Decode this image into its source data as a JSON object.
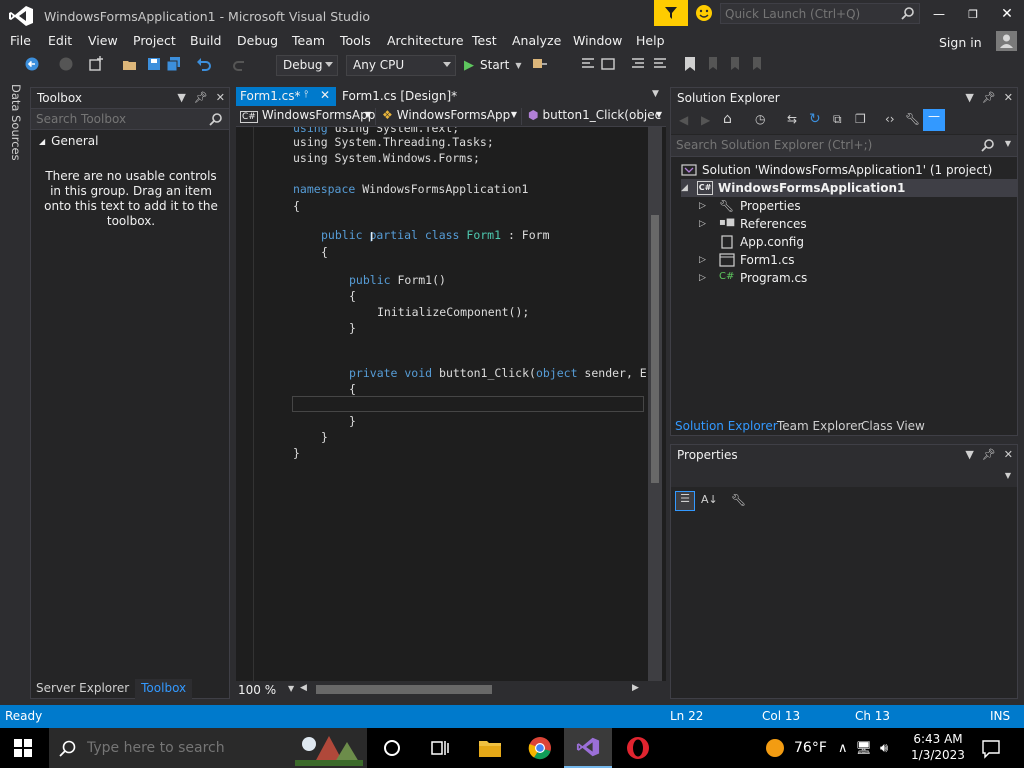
{
  "window": {
    "title": "WindowsFormsApplication1 - Microsoft Visual Studio",
    "quick_launch_placeholder": "Quick Launch (Ctrl+Q)"
  },
  "menu": [
    "File",
    "Edit",
    "View",
    "Project",
    "Build",
    "Debug",
    "Team",
    "Tools",
    "Architecture",
    "Test",
    "Analyze",
    "Window",
    "Help"
  ],
  "sign_in": "Sign in",
  "toolbar": {
    "config": "Debug",
    "platform": "Any CPU",
    "start": "Start"
  },
  "left_vertical_tab": "Data Sources",
  "toolbox": {
    "title": "Toolbox",
    "search_placeholder": "Search Toolbox",
    "group": "General",
    "empty_message": "There are no usable controls in this group. Drag an item onto this text to add it to the toolbox."
  },
  "left_bottom_tabs": [
    "Server Explorer",
    "Toolbox"
  ],
  "editor": {
    "tabs": [
      "Form1.cs*",
      "Form1.cs [Design]*"
    ],
    "nav": [
      "WindowsFormsApp",
      "WindowsFormsApp",
      "button1_Click(objec"
    ],
    "zoom": "100 %",
    "lines": {
      "l0": "using System.Text;",
      "l1": "using System.Threading.Tasks;",
      "l2": "using System.Windows.Forms;",
      "l3a": "namespace",
      "l3b": " WindowsFormsApplication1",
      "l4": "{",
      "l5a": "public partial class",
      "l5b": " Form1",
      "l5c": " : Form",
      "l6": "{",
      "l7a": "public",
      "l7b": " Form1()",
      "l8": "{",
      "l9": "InitializeComponent();",
      "l10": "}",
      "l11a": "private void",
      "l11b": " button1_Click(",
      "l11c": "object",
      "l11d": " sender, E",
      "l12": "{",
      "l13": "}",
      "l14": "}",
      "l15": "}"
    }
  },
  "solution_explorer": {
    "title": "Solution Explorer",
    "search_placeholder": "Search Solution Explorer (Ctrl+;)",
    "solution": "Solution 'WindowsFormsApplication1' (1 project)",
    "project": "WindowsFormsApplication1",
    "items": [
      "Properties",
      "References",
      "App.config",
      "Form1.cs",
      "Program.cs"
    ],
    "tabs": [
      "Solution Explorer",
      "Team Explorer",
      "Class View"
    ]
  },
  "properties": {
    "title": "Properties"
  },
  "status": {
    "ready": "Ready",
    "ln": "Ln 22",
    "col": "Col 13",
    "ch": "Ch 13",
    "ins": "INS"
  },
  "taskbar": {
    "search_placeholder": "Type here to search",
    "temperature": "76°F",
    "time": "6:43 AM",
    "date": "1/3/2023"
  },
  "colors": {
    "accent": "#007acc",
    "keyword": "#569cd6",
    "type": "#4ec9b0"
  }
}
